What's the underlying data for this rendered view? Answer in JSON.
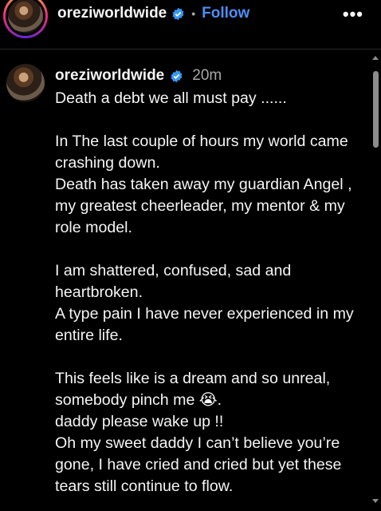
{
  "header": {
    "username": "oreziworldwide",
    "separator": "•",
    "follow_label": "Follow",
    "more_icon": "more-horizontal-icon",
    "more_glyph": "•••"
  },
  "comment": {
    "username": "oreziworldwide",
    "time": "20m",
    "text": "Death a debt we all must pay ......\n\nIn The last couple of hours my world came crashing down.\nDeath has taken away my guardian Angel , my greatest cheerleader, my mentor & my role model.\n\nI am shattered, confused, sad and heartbroken.\nA type pain I have never experienced in my entire life.\n\nThis feels like is a dream and so unreal, somebody pinch me 😭.\ndaddy please wake up !!\nOh my sweet daddy I can’t believe you’re gone, I have cried and cried but yet these tears still continue to flow."
  },
  "colors": {
    "background": "#000000",
    "text": "#f5f5f5",
    "muted": "#a8a8a8",
    "follow": "#4c8ef7",
    "verified": "#3897f0"
  }
}
